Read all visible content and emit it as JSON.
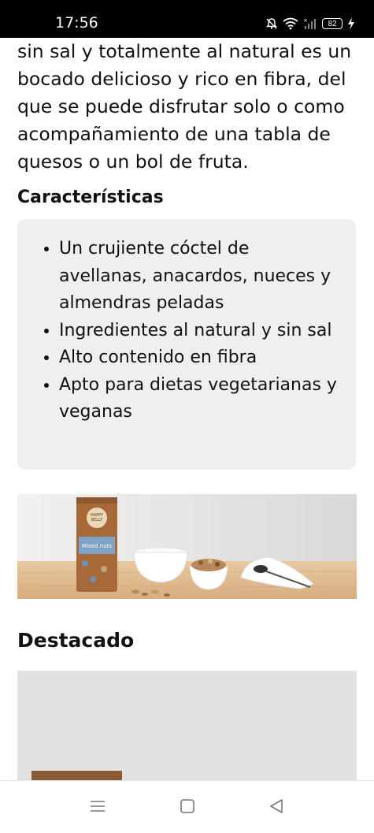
{
  "status_bar": {
    "time": "17:56",
    "battery": "82",
    "icons": [
      "mute-bell-icon",
      "wifi-icon",
      "signal-icon",
      "battery-icon",
      "charging-bolt-icon"
    ]
  },
  "article": {
    "intro_lines": [
      "sin sal y totalmente al natural es un",
      "bocado delicioso y rico en fibra, del",
      "que se puede disfrutar solo o como",
      "acompañamiento de una tabla de",
      "quesos o un bol de fruta."
    ],
    "features_heading": "Características",
    "features": [
      "Un crujiente cóctel de avellanas, anacardos, nueces y almendras peladas",
      "Ingredientes al natural y sin sal",
      "Alto contenido en fibra",
      "Apto para dietas vegetarianas y veganas"
    ],
    "product_image": {
      "package_text_top": "HAPPY BELLY",
      "package_text_label": "Mixed nuts"
    },
    "destacado_heading": "Destacado"
  },
  "nav_bar": {
    "icons": [
      "menu-icon",
      "home-square-icon",
      "back-triangle-icon"
    ]
  }
}
